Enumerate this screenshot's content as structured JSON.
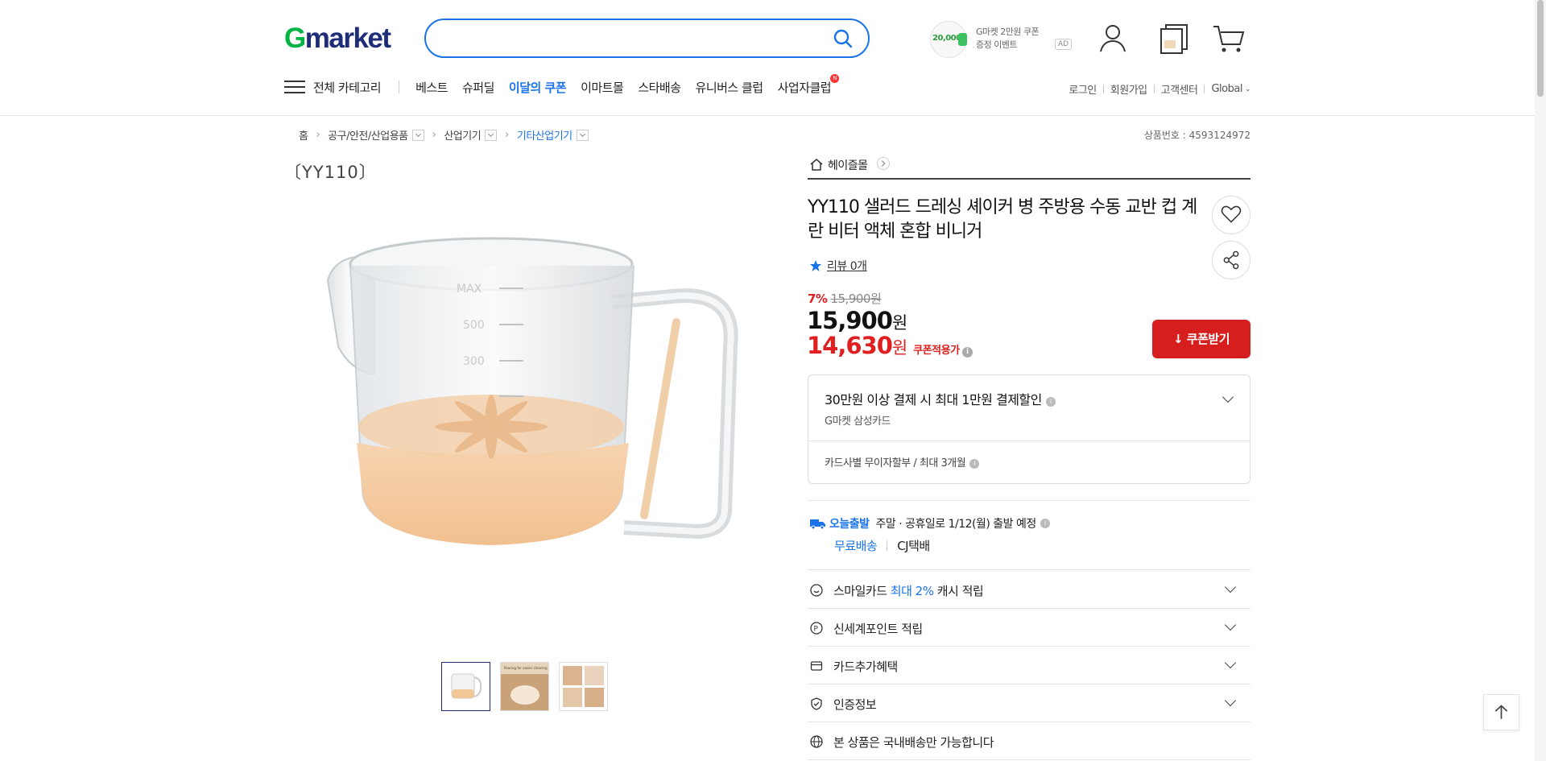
{
  "header": {
    "logo_g": "G",
    "logo_rest": "market",
    "search_placeholder": "",
    "ad": {
      "coin": "20,000",
      "line1": "G마켓 2만원 쿠폰",
      "line2": "증정 이벤트",
      "badge": "AD"
    }
  },
  "nav": {
    "all_categories": "전체 카테고리",
    "links": [
      "베스트",
      "슈퍼딜",
      "이달의 쿠폰",
      "이마트몰",
      "스타배송",
      "유니버스 클럽",
      "사업자클럽"
    ],
    "new_badge": "N",
    "util": [
      "로그인",
      "회원가입",
      "고객센터",
      "Global"
    ]
  },
  "breadcrumb": {
    "items": [
      "홈",
      "공구/안전/산업용품",
      "산업기기",
      "기타산업기기"
    ],
    "product_number": "상품번호 : 4593124972"
  },
  "gallery": {
    "brand_text": "〔YY110〕",
    "thumbnails": 3,
    "thumb2_caption": "Pouring for easier cleaning"
  },
  "product": {
    "shop_name": "헤이즐몰",
    "title": "YY110 샐러드 드레싱 셰이커 병 주방용 수동 교반 컵 계란 비터 액체 혼합 비니거",
    "review": "리뷰 0개",
    "discount_pct": "7%",
    "original_price": "15,900원",
    "price": "15,900",
    "price_unit": "원",
    "coupon_price": "14,630",
    "coupon_unit": "원",
    "coupon_label": "쿠폰적용가",
    "coupon_button": "쿠폰받기"
  },
  "card_offer": {
    "title": "30만원 이상 결제 시 최대 1만원 결제할인",
    "card": "G마켓 삼성카드",
    "installment": "카드사별 무이자할부 / 최대 3개월"
  },
  "shipping": {
    "badge": "오늘출발",
    "text": "주말 · 공휴일로 1/12(월) 출발 예정",
    "free": "무료배송",
    "courier": "CJ택배"
  },
  "rows": {
    "smile_pre": "스마일카드 ",
    "smile_hl": "최대 2%",
    "smile_post": " 캐시 적립",
    "point": "신세계포인트 적립",
    "card_benefit": "카드추가혜택",
    "cert": "인증정보",
    "domestic": "본 상품은 국내배송만 가능합니다"
  },
  "colors": {
    "primary": "#1a73e8",
    "sale": "#e02020",
    "coupon_btn": "#d61e1e",
    "logo_green": "#00b342",
    "logo_navy": "#1f2c78"
  }
}
